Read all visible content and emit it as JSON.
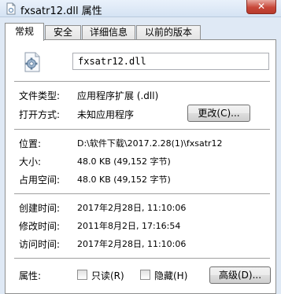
{
  "window": {
    "title": "fxsatr12.dll 属性",
    "close_glyph": "✕",
    "title_icon": "document-icon"
  },
  "tabs": [
    {
      "label": "常规",
      "active": true
    },
    {
      "label": "安全",
      "active": false
    },
    {
      "label": "详细信息",
      "active": false
    },
    {
      "label": "以前的版本",
      "active": false
    }
  ],
  "file": {
    "icon": "dll-file-gear-icon",
    "name": "fxsatr12.dll"
  },
  "type_section": {
    "type_label": "文件类型:",
    "type_value": "应用程序扩展 (.dll)",
    "open_label": "打开方式:",
    "open_value": "未知应用程序",
    "change_button": "更改(C)..."
  },
  "location_section": {
    "location_label": "位置:",
    "location_value": "D:\\软件下载\\2017.2.28(1)\\fxsatr12",
    "size_label": "大小:",
    "size_value": "48.0 KB (49,152 字节)",
    "disk_label": "占用空间:",
    "disk_value": "48.0 KB (49,152 字节)"
  },
  "time_section": {
    "created_label": "创建时间:",
    "created_value": "2017年2月28日, 11:10:06",
    "modified_label": "修改时间:",
    "modified_value": "2011年8月2日, 17:16:54",
    "accessed_label": "访问时间:",
    "accessed_value": "2017年2月28日, 11:10:06"
  },
  "attributes": {
    "label": "属性:",
    "readonly_label": "只读(R)",
    "readonly_checked": false,
    "hidden_label": "隐藏(H)",
    "hidden_checked": false,
    "advanced_button": "高级(D)..."
  }
}
